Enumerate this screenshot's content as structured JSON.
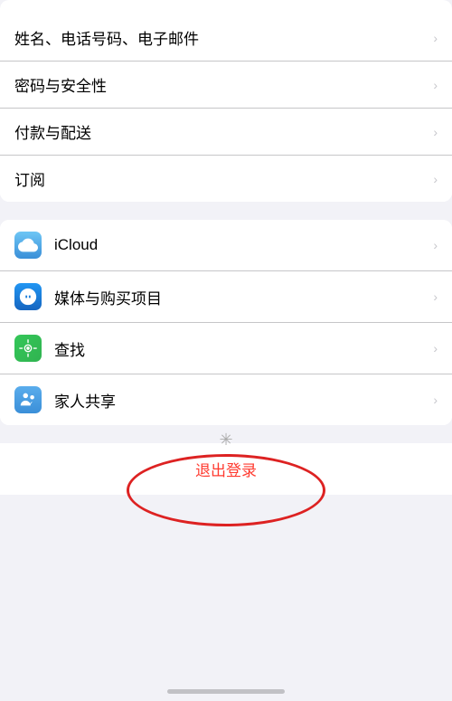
{
  "groups": {
    "group1": {
      "items": [
        {
          "id": "name-phone-email",
          "label": "姓名、电话号码、电子邮件",
          "hasIcon": false
        },
        {
          "id": "password-security",
          "label": "密码与安全性",
          "hasIcon": false
        },
        {
          "id": "payment-delivery",
          "label": "付款与配送",
          "hasIcon": false
        },
        {
          "id": "subscriptions",
          "label": "订阅",
          "hasIcon": false
        }
      ]
    },
    "group2": {
      "items": [
        {
          "id": "icloud",
          "label": "iCloud",
          "hasIcon": true,
          "iconType": "icloud"
        },
        {
          "id": "media-purchases",
          "label": "媒体与购买项目",
          "hasIcon": true,
          "iconType": "appstore"
        },
        {
          "id": "find",
          "label": "查找",
          "hasIcon": true,
          "iconType": "find"
        },
        {
          "id": "family-sharing",
          "label": "家人共享",
          "hasIcon": true,
          "iconType": "family"
        }
      ]
    }
  },
  "logout": {
    "label": "退出登录"
  },
  "colors": {
    "chevron": "#c7c7cc",
    "text": "#000000",
    "logout_text": "#ff3b30",
    "circle": "#dd2222",
    "background": "#f2f2f7"
  }
}
